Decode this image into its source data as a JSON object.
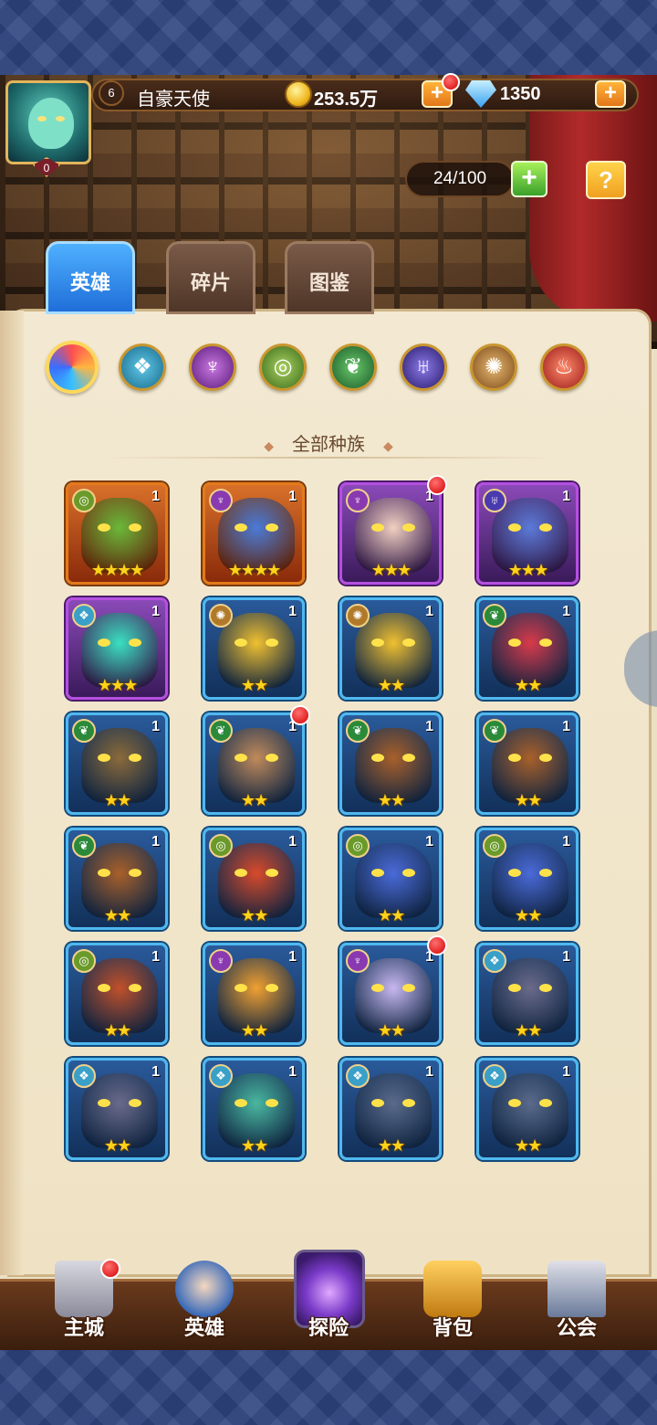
{
  "header": {
    "level": "6",
    "player_name": "自豪天使",
    "gold": "253.5万",
    "gems": "1350",
    "avatar_badge": "0",
    "hero_capacity": "24/100"
  },
  "tabs": [
    {
      "label": "英雄",
      "active": true
    },
    {
      "label": "碎片",
      "active": false
    },
    {
      "label": "图鉴",
      "active": false
    }
  ],
  "race_filter": {
    "title": "全部种族",
    "icons": [
      "all-races",
      "water",
      "dark",
      "wind",
      "nature",
      "demon",
      "light",
      "fire"
    ]
  },
  "colors": {
    "orange_frame": "#e37a1a",
    "purple_frame": "#b44fe0",
    "blue_frame": "#4fb8ef",
    "star": "#ffd21a",
    "active_tab": "#1f6ed8"
  },
  "heroes": [
    {
      "level": "1",
      "stars": "★★★★",
      "rarity": "orange",
      "race": "wind",
      "alert": false
    },
    {
      "level": "1",
      "stars": "★★★★",
      "rarity": "orange",
      "race": "dark",
      "alert": false
    },
    {
      "level": "1",
      "stars": "★★★",
      "rarity": "purple",
      "race": "dark",
      "alert": true
    },
    {
      "level": "1",
      "stars": "★★★",
      "rarity": "purple",
      "race": "demon",
      "alert": false
    },
    {
      "level": "1",
      "stars": "★★★",
      "rarity": "purple",
      "race": "water",
      "alert": false
    },
    {
      "level": "1",
      "stars": "★★",
      "rarity": "blue",
      "race": "light",
      "alert": false
    },
    {
      "level": "1",
      "stars": "★★",
      "rarity": "blue",
      "race": "light",
      "alert": false
    },
    {
      "level": "1",
      "stars": "★★",
      "rarity": "blue",
      "race": "nature",
      "alert": false
    },
    {
      "level": "1",
      "stars": "★★",
      "rarity": "blue",
      "race": "nature",
      "alert": false
    },
    {
      "level": "1",
      "stars": "★★",
      "rarity": "blue",
      "race": "nature",
      "alert": true
    },
    {
      "level": "1",
      "stars": "★★",
      "rarity": "blue",
      "race": "nature",
      "alert": false
    },
    {
      "level": "1",
      "stars": "★★",
      "rarity": "blue",
      "race": "nature",
      "alert": false
    },
    {
      "level": "1",
      "stars": "★★",
      "rarity": "blue",
      "race": "nature",
      "alert": false
    },
    {
      "level": "1",
      "stars": "★★",
      "rarity": "blue",
      "race": "wind",
      "alert": false
    },
    {
      "level": "1",
      "stars": "★★",
      "rarity": "blue",
      "race": "wind",
      "alert": false
    },
    {
      "level": "1",
      "stars": "★★",
      "rarity": "blue",
      "race": "wind",
      "alert": false
    },
    {
      "level": "1",
      "stars": "★★",
      "rarity": "blue",
      "race": "wind",
      "alert": false
    },
    {
      "level": "1",
      "stars": "★★",
      "rarity": "blue",
      "race": "dark",
      "alert": false
    },
    {
      "level": "1",
      "stars": "★★",
      "rarity": "blue",
      "race": "dark",
      "alert": true
    },
    {
      "level": "1",
      "stars": "★★",
      "rarity": "blue",
      "race": "water",
      "alert": false
    },
    {
      "level": "1",
      "stars": "★★",
      "rarity": "blue",
      "race": "water",
      "alert": false
    },
    {
      "level": "1",
      "stars": "★★",
      "rarity": "blue",
      "race": "water",
      "alert": false
    },
    {
      "level": "1",
      "stars": "★★",
      "rarity": "blue",
      "race": "water",
      "alert": false
    },
    {
      "level": "1",
      "stars": "★★",
      "rarity": "blue",
      "race": "water",
      "alert": false
    }
  ],
  "bottom_nav": [
    {
      "label": "主城",
      "icon": "castle-icon",
      "alert": true
    },
    {
      "label": "英雄",
      "icon": "hero-portrait-icon",
      "alert": false
    },
    {
      "label": "探险",
      "icon": "portal-icon",
      "alert": false
    },
    {
      "label": "背包",
      "icon": "backpack-icon",
      "alert": false
    },
    {
      "label": "公会",
      "icon": "guild-tower-icon",
      "alert": false
    }
  ]
}
